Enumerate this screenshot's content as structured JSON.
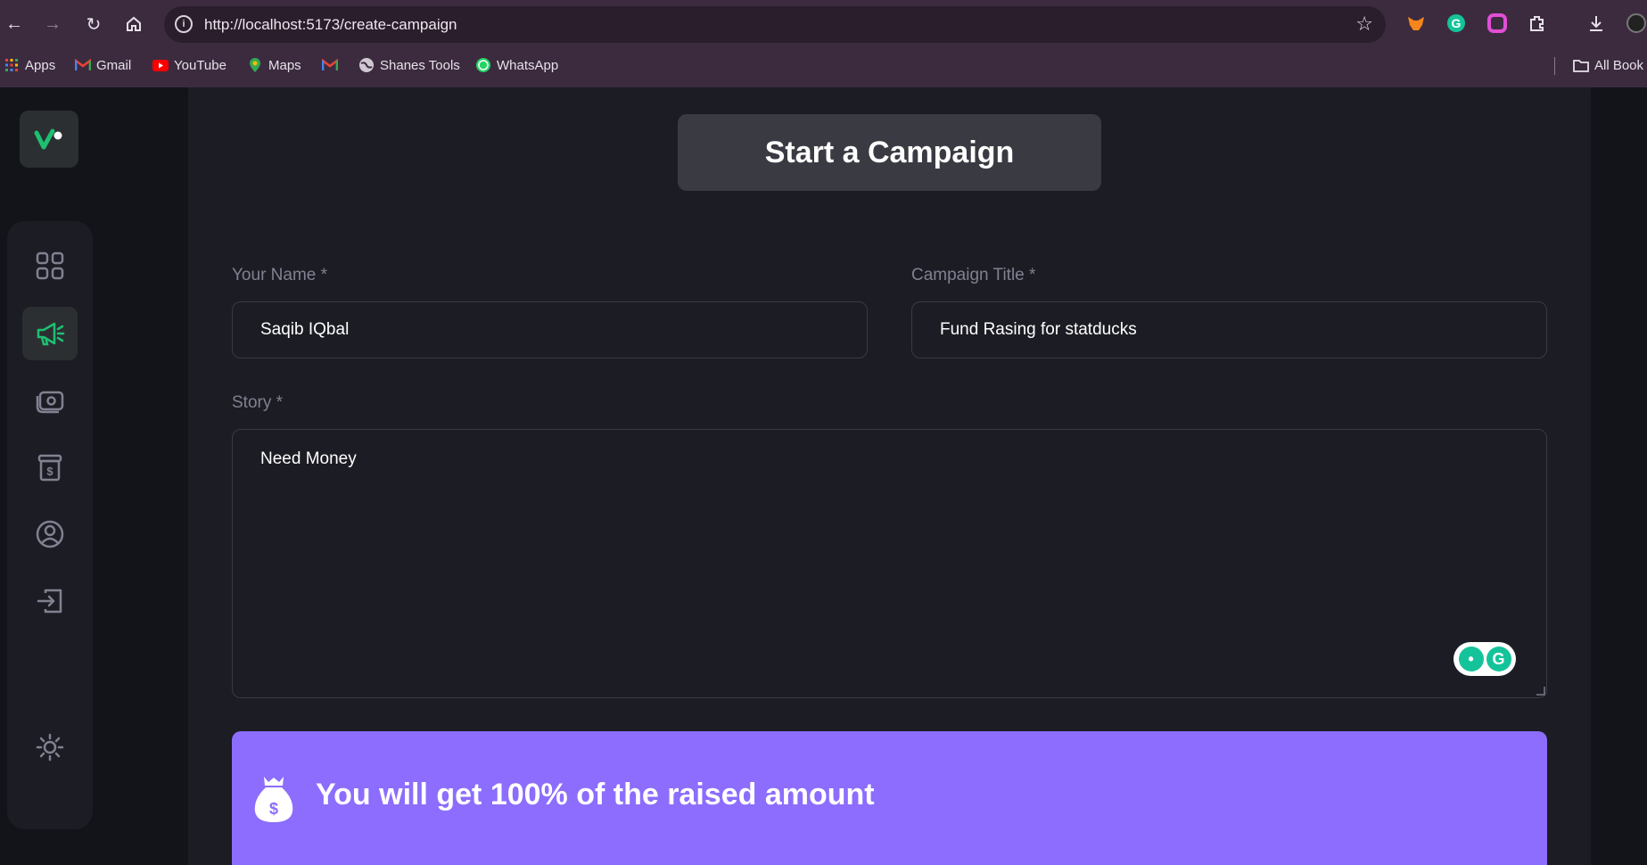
{
  "browser": {
    "url": "http://localhost:5173/create-campaign",
    "bookmarks": [
      {
        "label": "Apps",
        "icon": "apps-grid-icon"
      },
      {
        "label": "Gmail",
        "icon": "gmail-icon"
      },
      {
        "label": "YouTube",
        "icon": "youtube-icon"
      },
      {
        "label": "Maps",
        "icon": "maps-pin-icon"
      },
      {
        "label": "",
        "icon": "gmail-icon"
      },
      {
        "label": "Shanes Tools",
        "icon": "globe-icon"
      },
      {
        "label": "WhatsApp",
        "icon": "whatsapp-icon"
      }
    ],
    "all_bookmarks": "All Book"
  },
  "page": {
    "title": "Start a Campaign"
  },
  "form": {
    "name_label": "Your Name *",
    "name_value": "Saqib IQbal",
    "title_label": "Campaign Title *",
    "title_value": "Fund Rasing for statducks",
    "story_label": "Story *",
    "story_value": "Need Money"
  },
  "banner": {
    "text": "You will get 100% of the raised amount"
  },
  "colors": {
    "accent": "#1dc071",
    "banner": "#8c6dfd",
    "background": "#13131a",
    "panel": "#1c1c24"
  }
}
